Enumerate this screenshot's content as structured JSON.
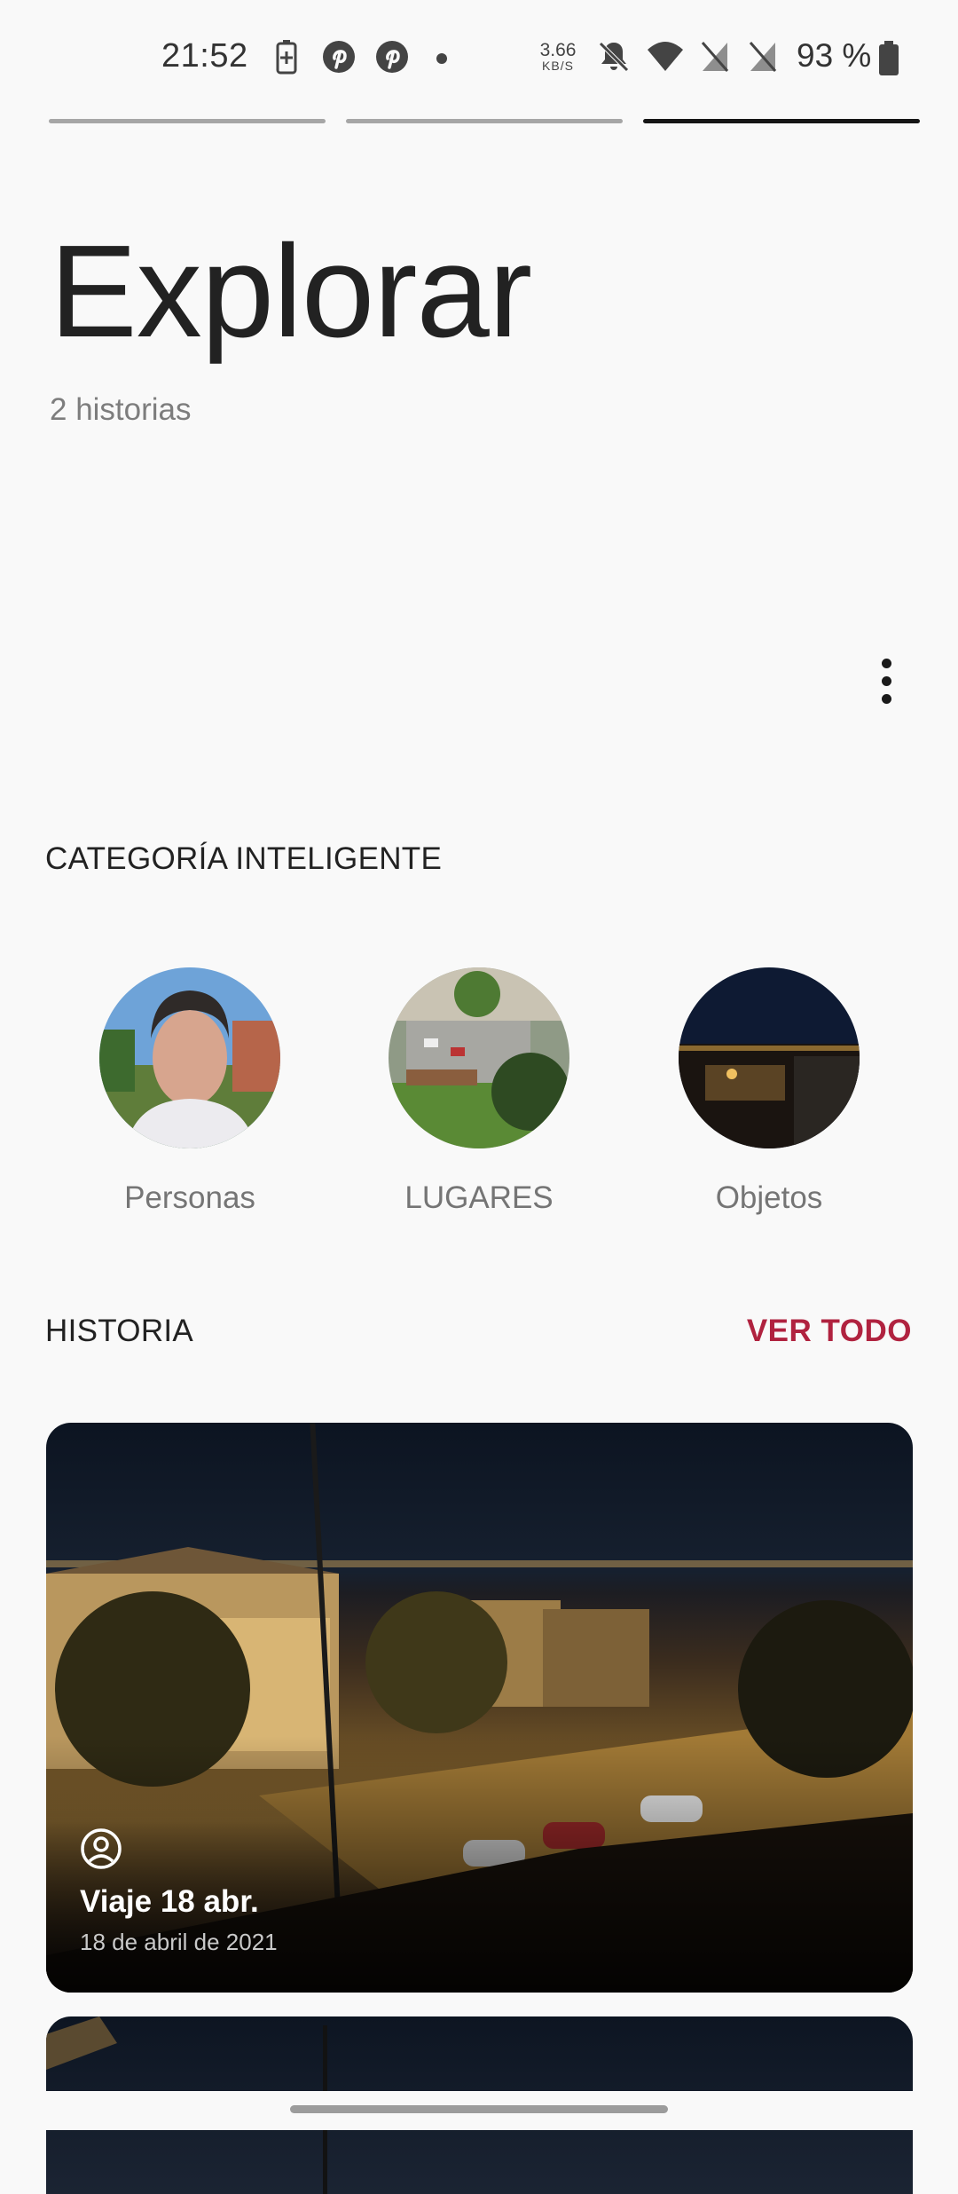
{
  "status_bar": {
    "time": "21:52",
    "network_speed": "3.66",
    "network_speed_unit": "KB/S",
    "battery": "93 %",
    "icons": [
      "battery-saver-icon",
      "pinterest-icon",
      "pinterest-icon",
      "dot-icon",
      "network-speed",
      "mute-icon",
      "wifi-icon",
      "no-sim-icon",
      "no-sim-icon",
      "battery-icon"
    ]
  },
  "story_progress": {
    "count": 3,
    "active_index": 2
  },
  "header": {
    "title": "Explorar",
    "subtitle": "2 historias"
  },
  "smart_category": {
    "label": "CATEGORÍA INTELIGENTE",
    "items": [
      {
        "label": "Personas"
      },
      {
        "label": "LUGARES"
      },
      {
        "label": "Objetos"
      }
    ]
  },
  "history": {
    "label": "HISTORIA",
    "see_all": "VER TODO",
    "cards": [
      {
        "title": "Viaje 18 abr.",
        "date": "18 de abril de 2021"
      }
    ]
  },
  "colors": {
    "accent": "#b0223f",
    "background": "#f9f9f9"
  }
}
